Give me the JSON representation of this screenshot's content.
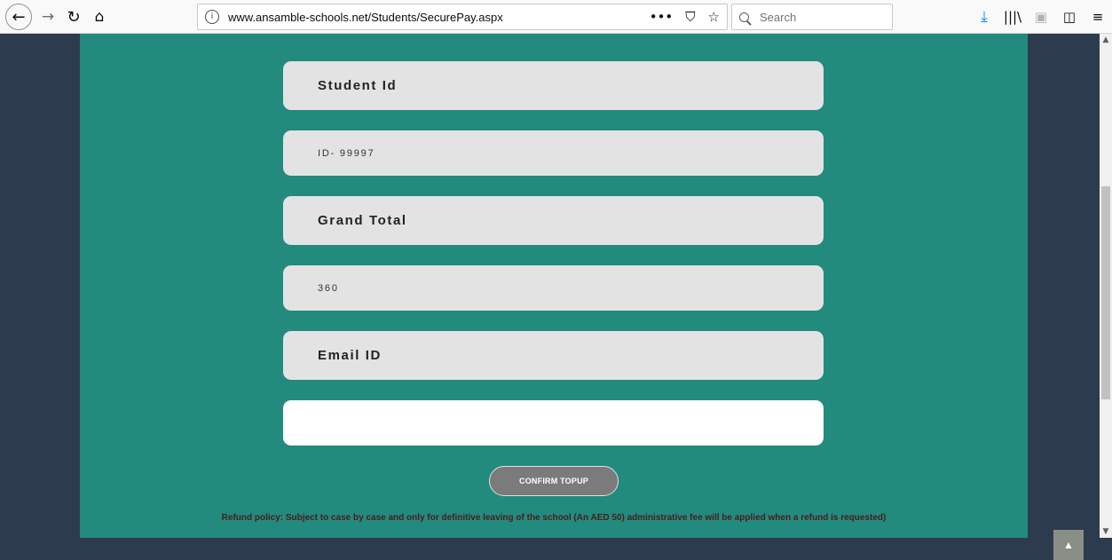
{
  "browser": {
    "back_glyph": "←",
    "forward_glyph": "→",
    "reload_glyph": "↻",
    "home_glyph": "⌂",
    "info_glyph": "i",
    "url": "www.ansamble-schools.net/Students/SecurePay.aspx",
    "more_glyph": "•••",
    "pocket_glyph": "⛉",
    "bookmark_glyph": "☆",
    "search_placeholder": "Search",
    "download_glyph": "⤓",
    "library_glyph": "|||\\",
    "reader_glyph": "▣",
    "sidebar_glyph": "◫",
    "menu_glyph": "≡"
  },
  "form": {
    "student_id_label": "Student Id",
    "student_id_value": "ID- 99997",
    "grand_total_label": "Grand Total",
    "grand_total_value": "360",
    "email_label": "Email ID",
    "email_value": "",
    "confirm_button": "CONFIRM TOPUP"
  },
  "refund_policy": "Refund policy:  Subject to case by case and only for definitive leaving of the school (An AED 50) administrative fee will be applied when a refund is requested)",
  "scroll_top_glyph": "▲",
  "colors": {
    "page_bg": "#2d3b4f",
    "panel_bg": "#238a7e",
    "field_bg": "#e3e3e3",
    "button_bg": "#7b7b7b"
  }
}
